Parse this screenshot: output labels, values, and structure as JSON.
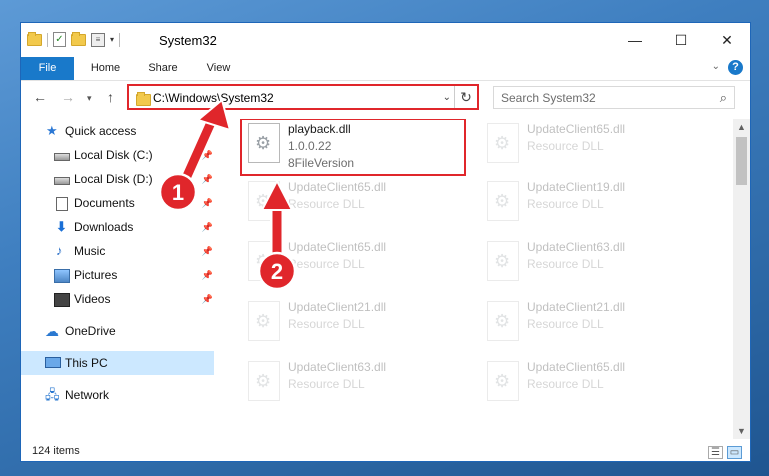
{
  "window": {
    "title": "System32"
  },
  "ribbon": {
    "tabs": [
      "File",
      "Home",
      "Share",
      "View"
    ],
    "help": "?"
  },
  "address": {
    "path": "C:\\Windows\\System32",
    "refresh": "↻"
  },
  "search": {
    "placeholder": "Search System32"
  },
  "sidebar": {
    "items": [
      {
        "label": "Quick access",
        "icon": "star-icon",
        "pinned": false
      },
      {
        "label": "Local Disk (C:)",
        "icon": "drive-icon",
        "pinned": true
      },
      {
        "label": "Local Disk (D:)",
        "icon": "drive-icon",
        "pinned": true
      },
      {
        "label": "Documents",
        "icon": "document-icon",
        "pinned": true
      },
      {
        "label": "Downloads",
        "icon": "download-icon",
        "pinned": true
      },
      {
        "label": "Music",
        "icon": "music-icon",
        "pinned": true
      },
      {
        "label": "Pictures",
        "icon": "pictures-icon",
        "pinned": true
      },
      {
        "label": "Videos",
        "icon": "video-icon",
        "pinned": true
      },
      {
        "label": "OneDrive",
        "icon": "cloud-icon",
        "pinned": false
      },
      {
        "label": "This PC",
        "icon": "computer-icon",
        "pinned": false,
        "selected": true
      },
      {
        "label": "Network",
        "icon": "network-icon",
        "pinned": false
      }
    ]
  },
  "files": {
    "highlighted": {
      "name": "playback.dll",
      "version": "1.0.0.22",
      "desc": "8FileVersion"
    },
    "col1": [
      {
        "name": "UpdateClient65.dll",
        "desc": "Resource DLL"
      },
      {
        "name": "UpdateClient65.dll",
        "desc": "Resource DLL"
      },
      {
        "name": "UpdateClient21.dll",
        "desc": "Resource DLL"
      },
      {
        "name": "UpdateClient63.dll",
        "desc": "Resource DLL"
      }
    ],
    "col2": [
      {
        "name": "UpdateClient65.dll",
        "desc": "Resource DLL"
      },
      {
        "name": "UpdateClient19.dll",
        "desc": "Resource DLL"
      },
      {
        "name": "UpdateClient63.dll",
        "desc": "Resource DLL"
      },
      {
        "name": "UpdateClient21.dll",
        "desc": "Resource DLL"
      },
      {
        "name": "UpdateClient65.dll",
        "desc": "Resource DLL"
      }
    ]
  },
  "status": {
    "count": "124 items"
  },
  "annotations": {
    "step1": "1",
    "step2": "2",
    "color": "#e0262b"
  }
}
